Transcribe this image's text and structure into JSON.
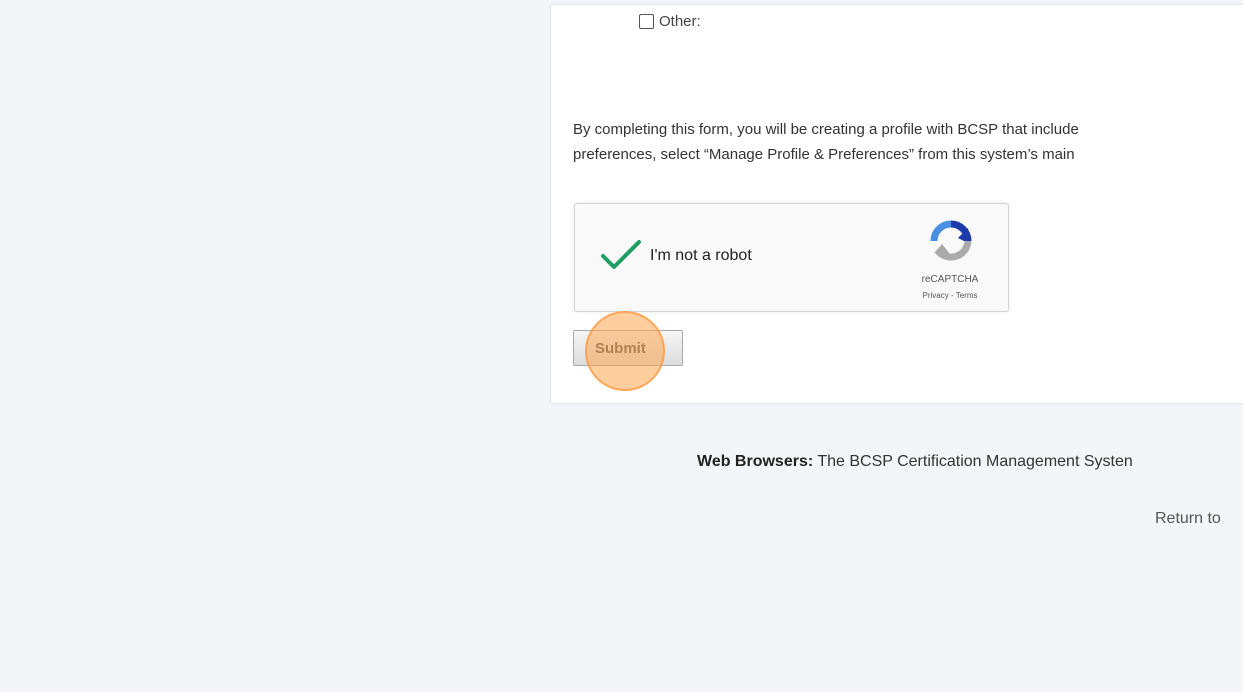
{
  "form": {
    "other_option_label": "Other:",
    "consent_line1": "By completing this form, you will be creating a profile with BCSP that include",
    "consent_line2": "preferences, select “Manage Profile & Preferences” from this system’s main",
    "recaptcha": {
      "label": "I'm not a robot",
      "brand": "reCAPTCHA",
      "privacy": "Privacy",
      "separator": " - ",
      "terms": "Terms"
    },
    "submit_label": "Submit"
  },
  "footer": {
    "browsers_heading": "Web Browsers:",
    "browsers_text": " The BCSP Certification Management Systen",
    "return_link": "Return to"
  },
  "colors": {
    "check_green": "#1e9e63",
    "click_highlight": "#ffa550"
  }
}
